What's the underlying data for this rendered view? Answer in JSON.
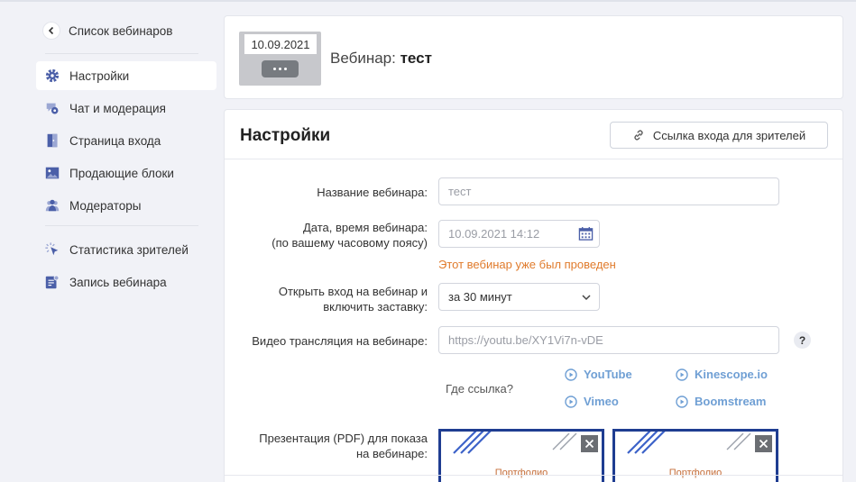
{
  "sidebar": {
    "back_label": "Список вебинаров",
    "items": [
      {
        "label": "Настройки",
        "icon": "gear-icon",
        "active": true
      },
      {
        "label": "Чат и модерация",
        "icon": "chat-moderation-icon"
      },
      {
        "label": "Страница входа",
        "icon": "entry-page-icon"
      },
      {
        "label": "Продающие блоки",
        "icon": "image-block-icon"
      },
      {
        "label": "Модераторы",
        "icon": "moderators-icon"
      },
      {
        "label": "Статистика зрителей",
        "icon": "statistics-cursor-icon"
      },
      {
        "label": "Запись вебинара",
        "icon": "recording-icon"
      }
    ]
  },
  "header": {
    "thumb_date": "10.09.2021",
    "title_prefix": "Вебинар:",
    "title_name": "тест"
  },
  "settings": {
    "title": "Настройки",
    "viewer_link_button": "Ссылка входа для зрителей",
    "name_label": "Название вебинара:",
    "name_value": "тест",
    "date_label_1": "Дата, время вебинара:",
    "date_label_2": "(по вашему часовому поясу)",
    "date_value": "10.09.2021 14:12",
    "date_warning": "Этот вебинар уже был проведен",
    "open_label_1": "Открыть вход на вебинар и",
    "open_label_2": "включить заставку:",
    "open_value": "за 30 минут",
    "video_label": "Видео трансляция на вебинаре:",
    "video_placeholder": "https://youtu.be/XY1Vi7n-vDE",
    "help_mark": "?",
    "where_link": "Где ссылка?",
    "services": [
      "YouTube",
      "Kinescope.io",
      "Vimeo",
      "Boomstream"
    ],
    "presentation_label_1": "Презентация (PDF) для показа",
    "presentation_label_2": "на вебинаре:",
    "presentation_slide_text": "Портфолио"
  },
  "colors": {
    "accent": "#6f9fd4",
    "warning": "#e07b2c",
    "sidebar_icon": "#4b5fa8",
    "slide_border": "#1f3d91"
  }
}
